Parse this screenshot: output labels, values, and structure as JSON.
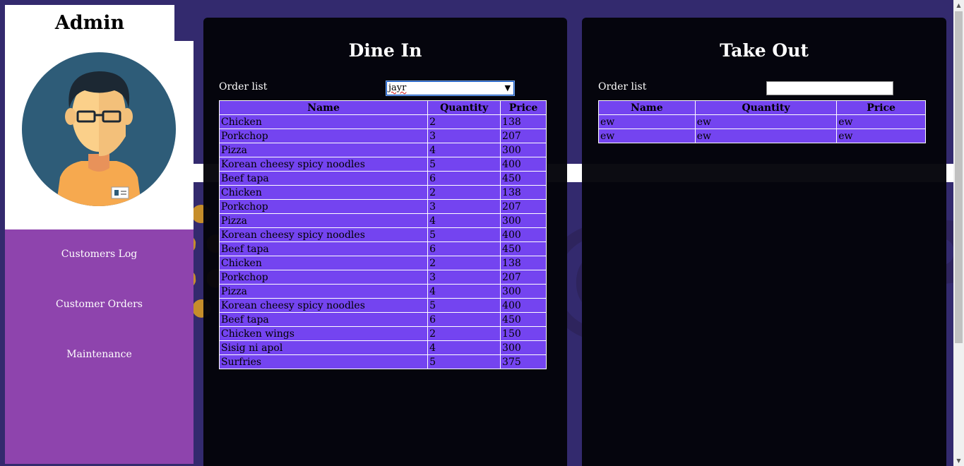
{
  "sidebar": {
    "title": "Admin",
    "nav": [
      {
        "label": "Customers Log"
      },
      {
        "label": "Customer Orders"
      },
      {
        "label": "Maintenance"
      }
    ]
  },
  "dine_in": {
    "title": "Dine In",
    "order_list_label": "Order list",
    "selected_customer": "jayr",
    "columns": [
      "Name",
      "Quantity",
      "Price"
    ],
    "rows": [
      [
        "Chicken",
        "2",
        "138"
      ],
      [
        "Porkchop",
        "3",
        "207"
      ],
      [
        "Pizza",
        "4",
        "300"
      ],
      [
        "Korean cheesy spicy noodles",
        "5",
        "400"
      ],
      [
        "Beef tapa",
        "6",
        "450"
      ],
      [
        "Chicken",
        "2",
        "138"
      ],
      [
        "Porkchop",
        "3",
        "207"
      ],
      [
        "Pizza",
        "4",
        "300"
      ],
      [
        "Korean cheesy spicy noodles",
        "5",
        "400"
      ],
      [
        "Beef tapa",
        "6",
        "450"
      ],
      [
        "Chicken",
        "2",
        "138"
      ],
      [
        "Porkchop",
        "3",
        "207"
      ],
      [
        "Pizza",
        "4",
        "300"
      ],
      [
        "Korean cheesy spicy noodles",
        "5",
        "400"
      ],
      [
        "Beef tapa",
        "6",
        "450"
      ],
      [
        "Chicken wings",
        "2",
        "150"
      ],
      [
        "Sisig ni apol",
        "4",
        "300"
      ],
      [
        "Surfries",
        "5",
        "375"
      ]
    ]
  },
  "take_out": {
    "title": "Take Out",
    "order_list_label": "Order list",
    "input_value": "",
    "columns": [
      "Name",
      "Quantity",
      "Price"
    ],
    "rows": [
      [
        "ew",
        "ew",
        "ew"
      ],
      [
        "ew",
        "ew",
        "ew"
      ]
    ]
  },
  "colors": {
    "page_bg": "#332a6e",
    "sidebar_nav": "#8e44ad",
    "table_bg": "#7444f0",
    "panel_bg": "#04040a"
  }
}
